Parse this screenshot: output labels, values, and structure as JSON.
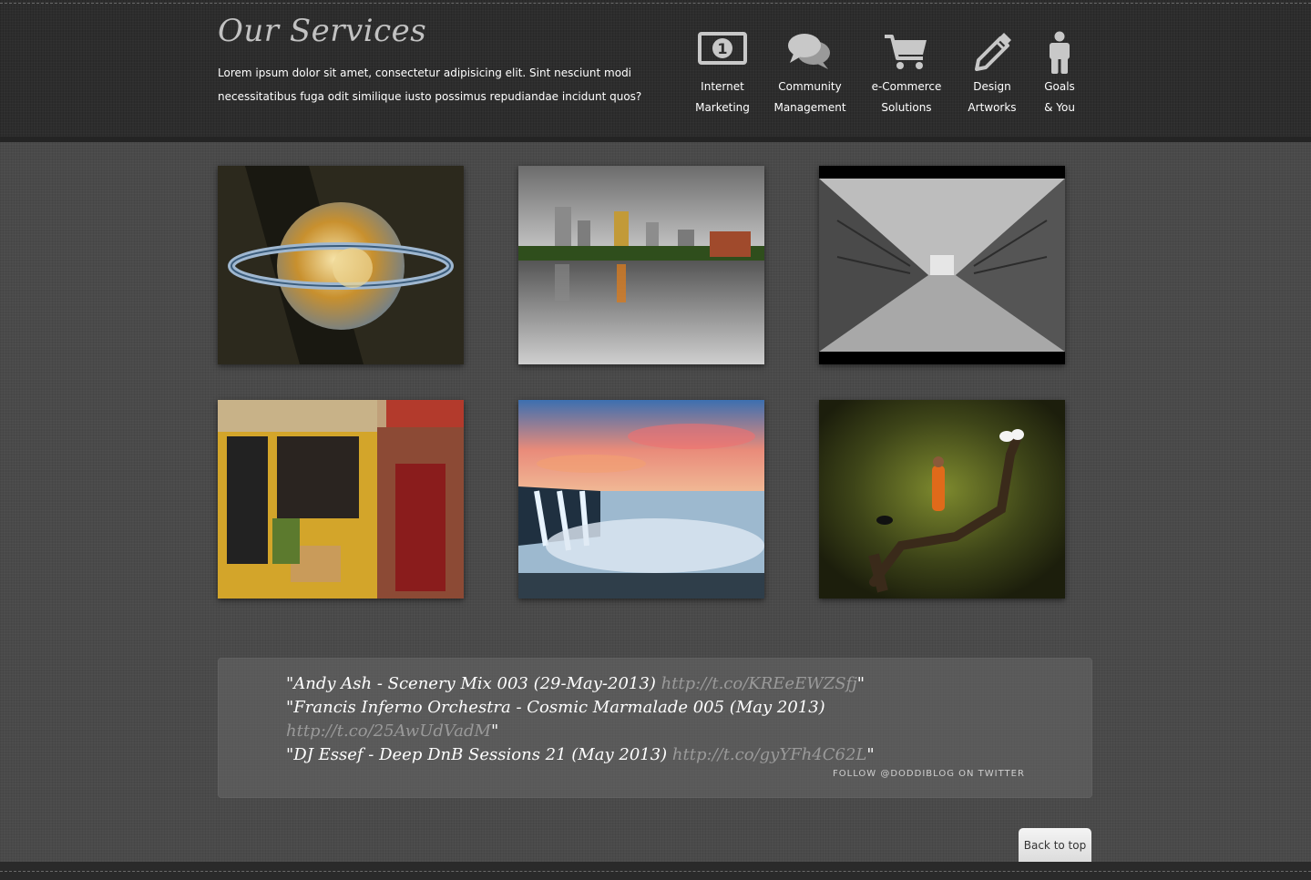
{
  "header": {
    "title": "Our Services",
    "intro_line1": "Lorem ipsum dolor sit amet, consectetur adipisicing elit. Sint nesciunt modi",
    "intro_line2": "necessitatibus fuga odit similique iusto possimus repudiandae incidunt quos?"
  },
  "services": [
    {
      "line1": "Internet",
      "line2": "Marketing",
      "icon": "money-icon"
    },
    {
      "line1": "Community",
      "line2": "Management",
      "icon": "chat-bubbles-icon"
    },
    {
      "line1": "e-Commerce",
      "line2": "Solutions",
      "icon": "shopping-cart-icon"
    },
    {
      "line1": "Design",
      "line2": "Artworks",
      "icon": "pencil-icon"
    },
    {
      "line1": "Goals",
      "line2": "& You",
      "icon": "person-icon"
    }
  ],
  "gallery": [
    {
      "subject": "glass-planet"
    },
    {
      "subject": "city-lake-reflection"
    },
    {
      "subject": "arcade-hallway"
    },
    {
      "subject": "restaurant-hotel-storefront"
    },
    {
      "subject": "waterfall-sunset"
    },
    {
      "subject": "monk-birds-tree"
    }
  ],
  "tweets": [
    {
      "text": "\"Andy Ash - Scenery Mix 003 (29-May-2013) ",
      "link": "http://t.co/KREeEWZSfj",
      "end": "\""
    },
    {
      "text": "\"Francis Inferno Orchestra - Cosmic Marmalade 005 (May 2013) ",
      "link": "http://t.co/25AwUdVadM",
      "end": "\""
    },
    {
      "text": "\"DJ Essef - Deep DnB Sessions 21 (May 2013) ",
      "link": "http://t.co/gyYFh4C62L",
      "end": "\""
    }
  ],
  "follow_label": "FOLLOW @DODDIBLOG ON TWITTER",
  "back_to_top": "Back to top",
  "colors": {
    "header_bg": "#2d2d2d",
    "body_bg": "#4a4a4a",
    "title": "#c2c2c2",
    "icon": "#c8c8c8",
    "link": "#9a9a9a"
  }
}
